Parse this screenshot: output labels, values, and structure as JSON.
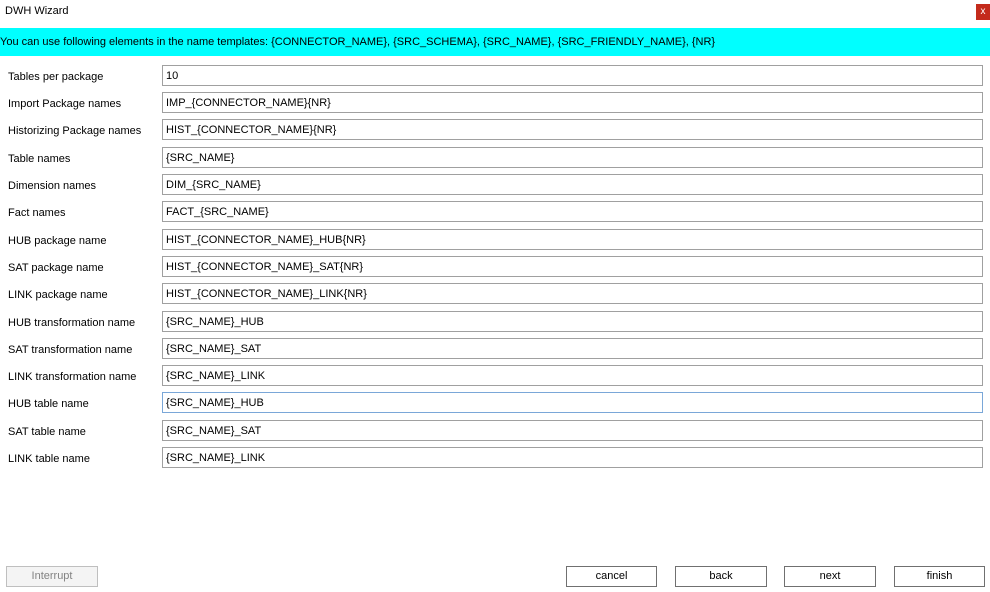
{
  "window": {
    "title": "DWH Wizard",
    "close_label": "x"
  },
  "info": {
    "text": "You can use following elements in the name templates: {CONNECTOR_NAME}, {SRC_SCHEMA}, {SRC_NAME}, {SRC_FRIENDLY_NAME}, {NR}"
  },
  "fields": [
    {
      "label": "Tables per package",
      "value": "10"
    },
    {
      "label": "Import Package names",
      "value": "IMP_{CONNECTOR_NAME}{NR}"
    },
    {
      "label": "Historizing Package names",
      "value": "HIST_{CONNECTOR_NAME}{NR}"
    },
    {
      "label": "Table names",
      "value": "{SRC_NAME}"
    },
    {
      "label": "Dimension names",
      "value": "DIM_{SRC_NAME}"
    },
    {
      "label": "Fact names",
      "value": "FACT_{SRC_NAME}"
    },
    {
      "label": "HUB package name",
      "value": "HIST_{CONNECTOR_NAME}_HUB{NR}"
    },
    {
      "label": "SAT package name",
      "value": "HIST_{CONNECTOR_NAME}_SAT{NR}"
    },
    {
      "label": "LINK package name",
      "value": "HIST_{CONNECTOR_NAME}_LINK{NR}"
    },
    {
      "label": "HUB transformation name",
      "value": "{SRC_NAME}_HUB"
    },
    {
      "label": "SAT transformation name",
      "value": "{SRC_NAME}_SAT"
    },
    {
      "label": "LINK transformation name",
      "value": "{SRC_NAME}_LINK"
    },
    {
      "label": "HUB table name",
      "value": "{SRC_NAME}_HUB"
    },
    {
      "label": "SAT table name",
      "value": "{SRC_NAME}_SAT"
    },
    {
      "label": "LINK table name",
      "value": "{SRC_NAME}_LINK"
    }
  ],
  "buttons": {
    "interrupt": "Interrupt",
    "cancel": "cancel",
    "back": "back",
    "next": "next",
    "finish": "finish"
  },
  "colors": {
    "info_bar": "#00ffff",
    "close_button": "#c42b1c"
  }
}
